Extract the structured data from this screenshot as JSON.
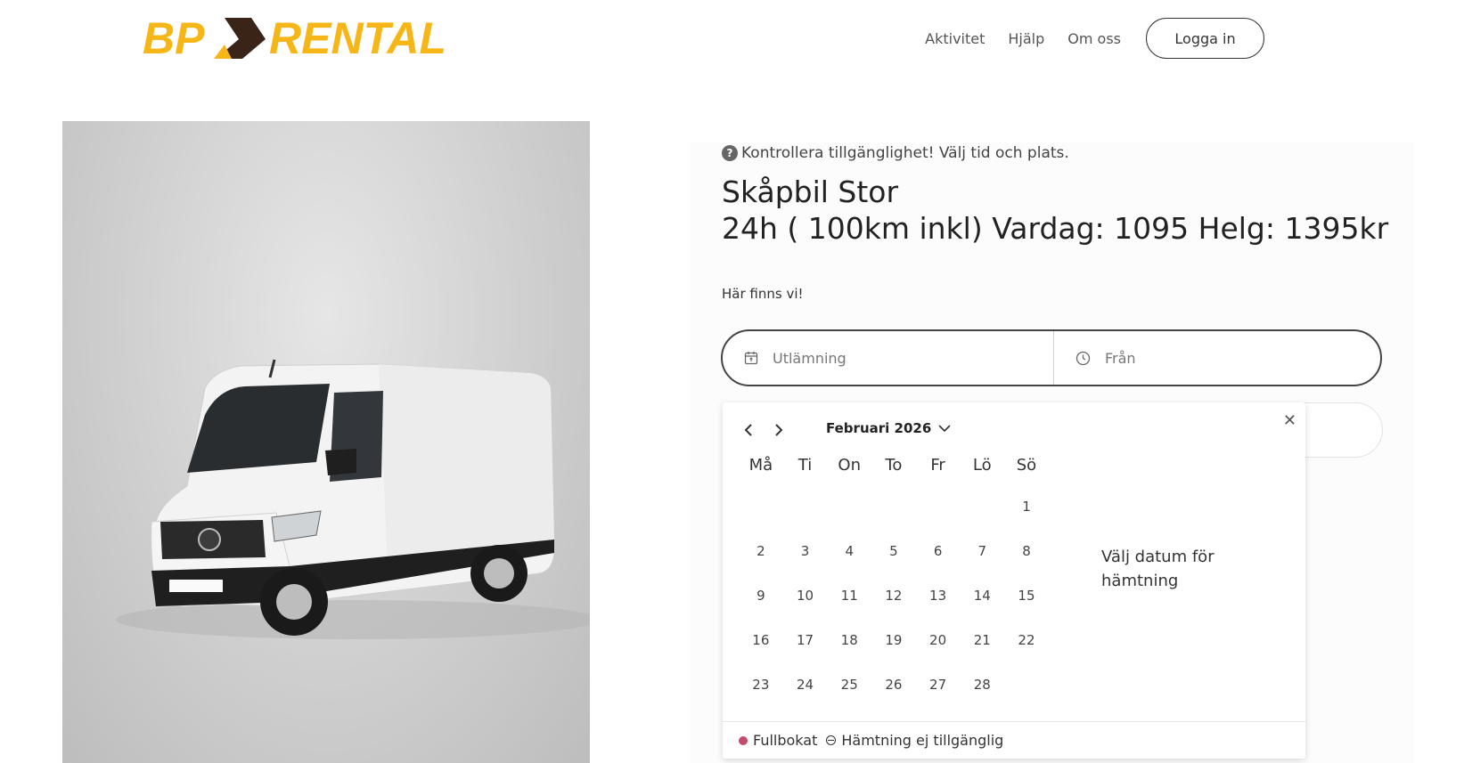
{
  "brand": {
    "logo_text": "BP RENTAL",
    "logo_part1": "BP",
    "logo_part2": "RENTAL",
    "accent": "#F7B618",
    "dark": "#3a2418"
  },
  "nav": {
    "items": [
      {
        "label": "Aktivitet"
      },
      {
        "label": "Hjälp"
      },
      {
        "label": "Om oss"
      }
    ],
    "login_label": "Logga in"
  },
  "product": {
    "hint": "Kontrollera tillgänglighet! Välj tid och plats.",
    "title": "Skåpbil Stor",
    "subtitle": "24h ( 100km inkl) Vardag: 1095 Helg: 1395kr",
    "location_label": "Här finns vi!"
  },
  "picker": {
    "date_placeholder": "Utlämning",
    "time_placeholder": "Från"
  },
  "calendar": {
    "month_label": "Februari 2026",
    "weekdays": [
      "Må",
      "Ti",
      "On",
      "To",
      "Fr",
      "Lö",
      "Sö"
    ],
    "days": [
      "",
      "",
      "",
      "",
      "",
      "",
      "1",
      "2",
      "3",
      "4",
      "5",
      "6",
      "7",
      "8",
      "9",
      "10",
      "11",
      "12",
      "13",
      "14",
      "15",
      "16",
      "17",
      "18",
      "19",
      "20",
      "21",
      "22",
      "23",
      "24",
      "25",
      "26",
      "27",
      "28",
      ""
    ],
    "side_message": "Välj datum för hämtning",
    "legend_full": "Fullbokat",
    "legend_unavailable": "Hämtning ej tillgänglig"
  }
}
